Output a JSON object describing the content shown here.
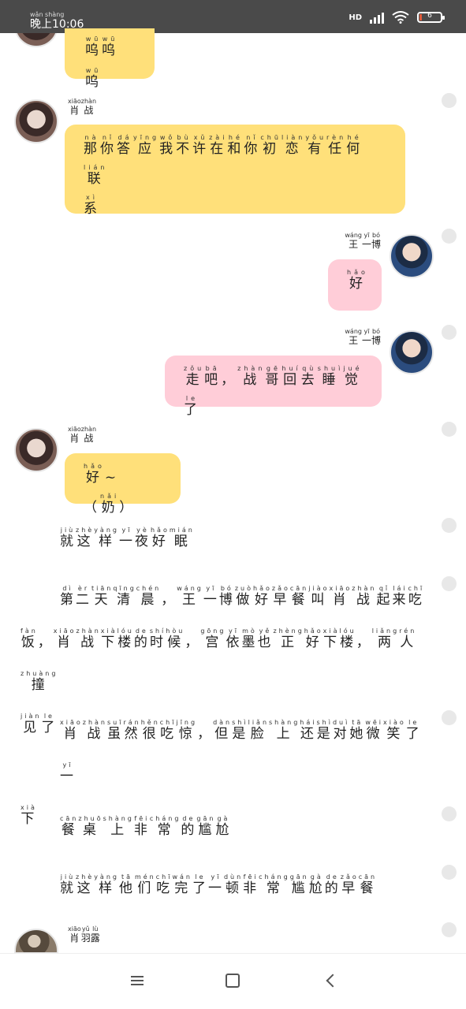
{
  "status": {
    "time_pinyin": "wǎn shàng",
    "time": "晚上10:06",
    "network": "HD",
    "battery": "6"
  },
  "messages": [
    {
      "sender": "xiaozhan",
      "text_pinyin": [
        "wū",
        "wū",
        "wū"
      ],
      "text": [
        "呜",
        "呜",
        "呜"
      ]
    },
    {
      "sender_label": [
        "肖",
        "战"
      ],
      "sender_pinyin": [
        "xiāo",
        "zhàn"
      ],
      "lines": [
        {
          "chars": [
            "那",
            "你",
            "答",
            "应",
            "我",
            "不",
            "许",
            "在",
            "和",
            "你",
            "初",
            "恋",
            "有",
            "任",
            "何",
            "联"
          ],
          "py": [
            "nà",
            "nǐ",
            "dá",
            "yīng",
            "wǒ",
            "bù",
            "xǔ",
            "zài",
            "hé",
            "nǐ",
            "chū",
            "liàn",
            "yǒu",
            "rèn",
            "hé",
            "lián"
          ]
        },
        {
          "chars": [
            "系"
          ],
          "py": [
            "xì"
          ]
        }
      ]
    },
    {
      "sender_label": [
        "王",
        "一",
        "博"
      ],
      "sender_pinyin": [
        "wáng",
        "yī",
        "bó"
      ],
      "lines": [
        {
          "chars": [
            "好"
          ],
          "py": [
            "hǎo"
          ]
        }
      ]
    },
    {
      "sender_label": [
        "王",
        "一",
        "博"
      ],
      "sender_pinyin": [
        "wáng",
        "yī",
        "bó"
      ],
      "lines": [
        {
          "chars": [
            "走",
            "吧",
            "，",
            "战",
            "哥",
            "回",
            "去",
            "睡",
            "觉",
            "了"
          ],
          "py": [
            "zǒu",
            "bā",
            "",
            "zhàn",
            "gē",
            "huí",
            "qù",
            "shuì",
            "jué",
            "le"
          ]
        }
      ]
    },
    {
      "sender_label": [
        "肖",
        "战"
      ],
      "sender_pinyin": [
        "xiāo",
        "zhàn"
      ],
      "lines": [
        {
          "chars": [
            "好",
            "~",
            "（",
            "奶",
            "）"
          ],
          "py": [
            "hǎo",
            "",
            "",
            "nǎi",
            ""
          ]
        }
      ]
    }
  ],
  "narration": [
    {
      "lines": [
        {
          "chars": [
            "就",
            "这",
            "样",
            "一",
            "夜",
            "好",
            "眠"
          ],
          "py": [
            "jiù",
            "zhè",
            "yàng",
            "yī",
            "yè",
            "hǎo",
            "mián"
          ]
        }
      ]
    },
    {
      "lines": [
        {
          "chars": [
            "第",
            "二",
            "天",
            "清",
            "晨",
            "，",
            "王",
            "一",
            "博",
            "做",
            "好",
            "早",
            "餐",
            "叫",
            "肖",
            "战",
            "起",
            "来",
            "吃"
          ],
          "py": [
            "dì",
            "èr",
            "tiān",
            "qīng",
            "chén",
            "",
            "wáng",
            "yī",
            "bó",
            "zuò",
            "hǎo",
            "zǎo",
            "cān",
            "jiào",
            "xiāo",
            "zhàn",
            "qǐ",
            "lái",
            "chī"
          ]
        },
        {
          "chars": [
            "饭",
            "，",
            "肖",
            "战",
            "下",
            "楼",
            "的",
            "时",
            "候",
            "，",
            "宫",
            "依",
            "墨",
            "也",
            "正",
            "好",
            "下",
            "楼",
            "，",
            "两",
            "人",
            "撞"
          ],
          "py": [
            "fàn",
            "",
            "xiāo",
            "zhàn",
            "xià",
            "lóu",
            "de",
            "shí",
            "hòu",
            "",
            "gōng",
            "yī",
            "mò",
            "yě",
            "zhèng",
            "hǎo",
            "xià",
            "lóu",
            "",
            "liǎng",
            "rén",
            "zhuàng"
          ]
        },
        {
          "chars": [
            "见",
            "了"
          ],
          "py": [
            "jiàn",
            "le"
          ]
        }
      ]
    },
    {
      "lines": [
        {
          "chars": [
            "肖",
            "战",
            "虽",
            "然",
            "很",
            "吃",
            "惊",
            "，",
            "但",
            "是",
            "脸",
            "上",
            "还",
            "是",
            "对",
            "她",
            "微",
            "笑",
            "了",
            "一"
          ],
          "py": [
            "xiāo",
            "zhàn",
            "suī",
            "rán",
            "hěn",
            "chī",
            "jīng",
            "",
            "dàn",
            "shì",
            "liǎn",
            "shàng",
            "hái",
            "shì",
            "duì",
            "tā",
            "wēi",
            "xiào",
            "le",
            "yī"
          ]
        },
        {
          "chars": [
            "下"
          ],
          "py": [
            "xià"
          ]
        }
      ]
    },
    {
      "lines": [
        {
          "chars": [
            "餐",
            "桌",
            "上",
            "非",
            "常",
            "的",
            "尴",
            "尬"
          ],
          "py": [
            "cān",
            "zhuō",
            "shàng",
            "fēi",
            "cháng",
            "de",
            "gān",
            "gà"
          ]
        }
      ]
    },
    {
      "lines": [
        {
          "chars": [
            "就",
            "这",
            "样",
            "他",
            "们",
            "吃",
            "完",
            "了",
            "一",
            "顿",
            "非",
            "常",
            "尴",
            "尬",
            "的",
            "早",
            "餐"
          ],
          "py": [
            "jiù",
            "zhè",
            "yàng",
            "tā",
            "mén",
            "chī",
            "wán",
            "le",
            "yī",
            "dùn",
            "fēi",
            "cháng",
            "gān",
            "gà",
            "de",
            "zǎo",
            "cān"
          ]
        }
      ]
    }
  ],
  "last_sender": {
    "label": [
      "肖",
      "羽",
      "露"
    ],
    "pinyin": [
      "xiāo",
      "yǔ",
      "lù"
    ]
  },
  "colors": {
    "xiaozhan_bubble": "#ffe07a",
    "wangyibo_bubble": "#ffcdd8",
    "status_bar": "#4a4a4a"
  },
  "icons": {
    "nav_menu": "menu-icon",
    "nav_home": "home-icon",
    "nav_back": "back-icon"
  }
}
